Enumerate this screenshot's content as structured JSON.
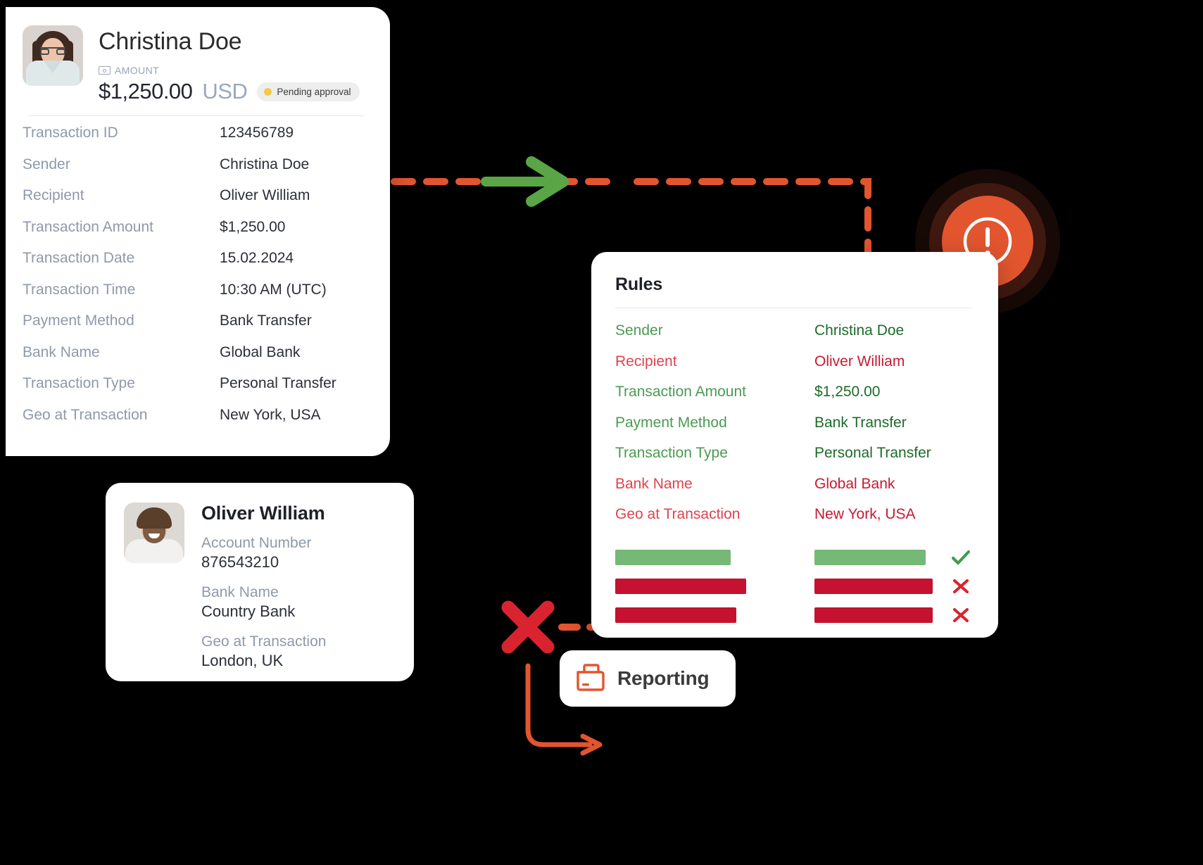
{
  "transaction_card": {
    "name": "Christina Doe",
    "amount_label": "AMOUNT",
    "amount_value": "$1,250.00",
    "currency": "USD",
    "status_badge": "Pending approval",
    "avatar_name": "christina-doe-avatar",
    "rows": [
      {
        "key": "Transaction ID",
        "value": "123456789"
      },
      {
        "key": "Sender",
        "value": "Christina Doe"
      },
      {
        "key": "Recipient",
        "value": "Oliver William"
      },
      {
        "key": "Transaction Amount",
        "value": "$1,250.00"
      },
      {
        "key": "Transaction Date",
        "value": "15.02.2024"
      },
      {
        "key": "Transaction Time",
        "value": "10:30 AM (UTC)"
      },
      {
        "key": "Payment Method",
        "value": "Bank Transfer"
      },
      {
        "key": "Bank Name",
        "value": "Global Bank"
      },
      {
        "key": "Transaction Type",
        "value": "Personal Transfer"
      },
      {
        "key": "Geo at Transaction",
        "value": "New York, USA"
      }
    ]
  },
  "recipient_card": {
    "name": "Oliver William",
    "fields": [
      {
        "key": "Account Number",
        "value": "876543210"
      },
      {
        "key": "Bank Name",
        "value": "Country Bank"
      },
      {
        "key": "Geo at Transaction",
        "value": "London, UK"
      }
    ]
  },
  "rules_card": {
    "title": "Rules",
    "rows": [
      {
        "key": "Sender",
        "value": "Christina Doe",
        "status": "ok"
      },
      {
        "key": "Recipient",
        "value": "Oliver William",
        "status": "bad"
      },
      {
        "key": "Transaction Amount",
        "value": "$1,250.00",
        "status": "ok"
      },
      {
        "key": "Payment Method",
        "value": "Bank Transfer",
        "status": "ok"
      },
      {
        "key": "Transaction Type",
        "value": "Personal Transfer",
        "status": "ok"
      },
      {
        "key": "Bank Name",
        "value": "Global Bank",
        "status": "bad"
      },
      {
        "key": "Geo at Transaction",
        "value": "New York, USA",
        "status": "bad"
      }
    ],
    "bars": [
      {
        "status": "ok",
        "mark": "check"
      },
      {
        "status": "bad",
        "mark": "cross"
      },
      {
        "status": "bad",
        "mark": "cross"
      }
    ]
  },
  "reporting": {
    "label": "Reporting",
    "icon": "folder-icon"
  },
  "alert": {
    "icon": "exclamation-circle-icon"
  },
  "colors": {
    "green": "#4c9a52",
    "green_value": "#1d6b2a",
    "green_bar": "#76b875",
    "red": "#e0434f",
    "red_value": "#c81932",
    "red_bar": "#c41230",
    "orange": "#e2552f",
    "cross_red": "#d9232e",
    "muted": "#8f99ab",
    "badge_dot": "#f2c94c"
  }
}
